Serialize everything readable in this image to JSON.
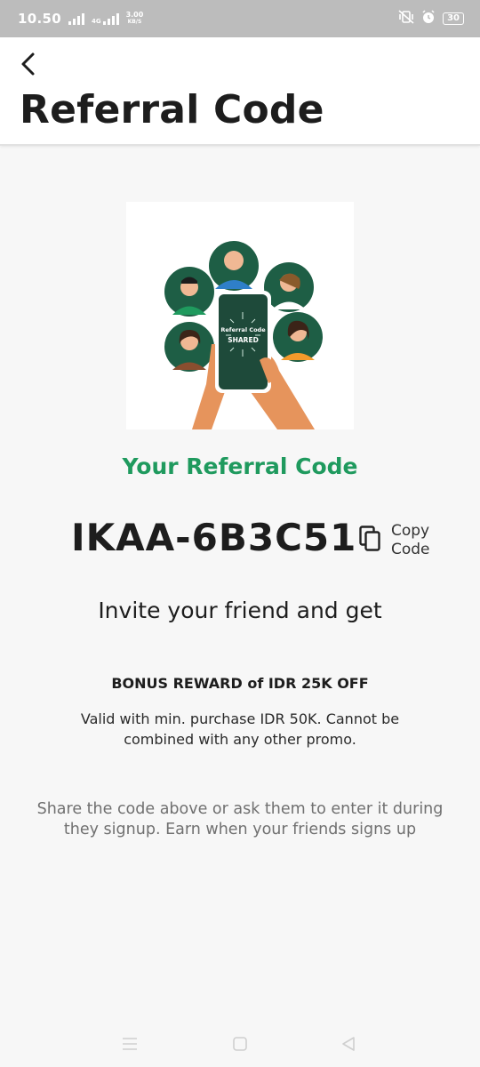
{
  "status_bar": {
    "time": "10.50",
    "network_type": "4G",
    "speed_value": "3.00",
    "speed_unit": "KB/S",
    "battery": "30"
  },
  "header": {
    "title": "Referral Code"
  },
  "illustration": {
    "phone_text_line1": "Referral Code",
    "phone_text_line2": "SHARED"
  },
  "referral": {
    "label": "Your Referral Code",
    "code": "IKAA-6B3C51",
    "copy_label": "Copy Code"
  },
  "invite": {
    "headline": "Invite your friend and get",
    "bonus_title": "BONUS REWARD of IDR 25K OFF",
    "bonus_desc": "Valid with min. purchase IDR 50K. Cannot be combined with any other promo.",
    "share_desc": "Share the code above or ask them to enter it during they signup. Earn when your friends signs up"
  },
  "colors": {
    "accent_green": "#1f9a5e",
    "dark_green": "#1e5e45"
  }
}
